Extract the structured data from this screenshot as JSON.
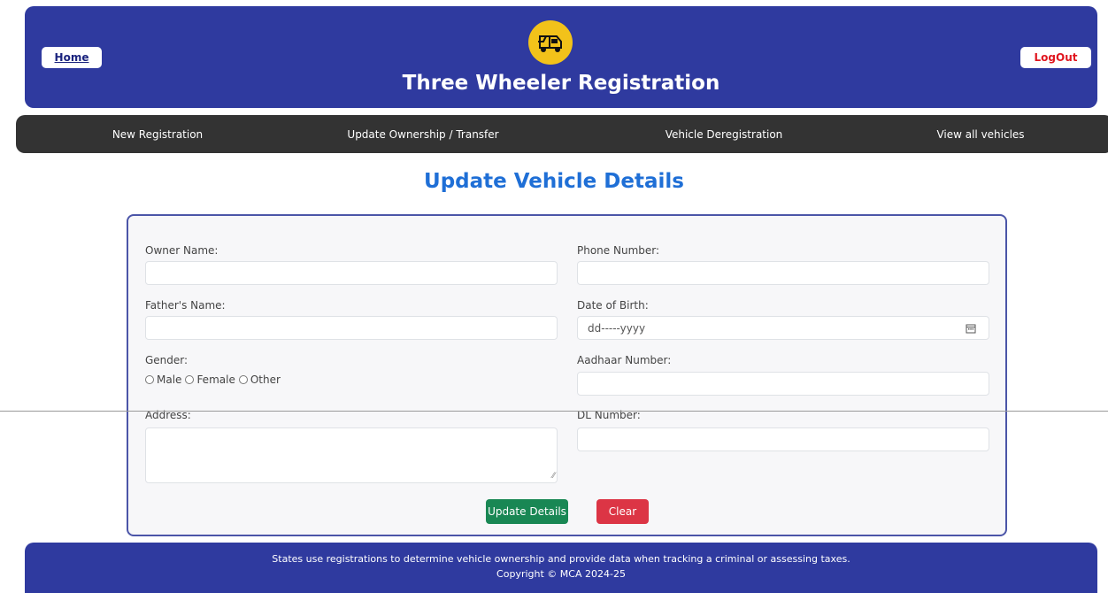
{
  "header": {
    "home_label": "Home",
    "logout_label": "LogOut",
    "title": "Three Wheeler Registration",
    "logo_icon": "auto-rickshaw-icon"
  },
  "nav": {
    "items": [
      {
        "label": "New Registration"
      },
      {
        "label": "Update Ownership / Transfer"
      },
      {
        "label": "Vehicle Deregistration"
      },
      {
        "label": "View all vehicles"
      }
    ]
  },
  "page": {
    "title": "Update Vehicle Details"
  },
  "form": {
    "owner_name": {
      "label": "Owner Name:",
      "value": ""
    },
    "phone_number": {
      "label": "Phone Number:",
      "value": ""
    },
    "fathers_name": {
      "label": "Father's Name:",
      "value": ""
    },
    "date_of_birth": {
      "label": "Date of Birth:",
      "value": "dd-----yyyy"
    },
    "gender": {
      "label": "Gender:",
      "options": [
        "Male",
        "Female",
        "Other"
      ]
    },
    "aadhaar_number": {
      "label": "Aadhaar Number:",
      "value": ""
    },
    "address": {
      "label": "Address:",
      "value": ""
    },
    "dl_number": {
      "label": "DL Number:",
      "value": ""
    },
    "update_label": "Update Details",
    "clear_label": "Clear"
  },
  "footer": {
    "line1": "States use registrations to determine vehicle ownership and provide data when tracking a criminal or assessing taxes.",
    "line2": "Copyright © MCA 2024-25"
  },
  "colors": {
    "header_bg": "#2f3a9f",
    "nav_bg": "#333333",
    "title_blue": "#1f6fd6",
    "update_green": "#198754",
    "clear_red": "#dc3545",
    "logo_yellow": "#f2c21a"
  }
}
